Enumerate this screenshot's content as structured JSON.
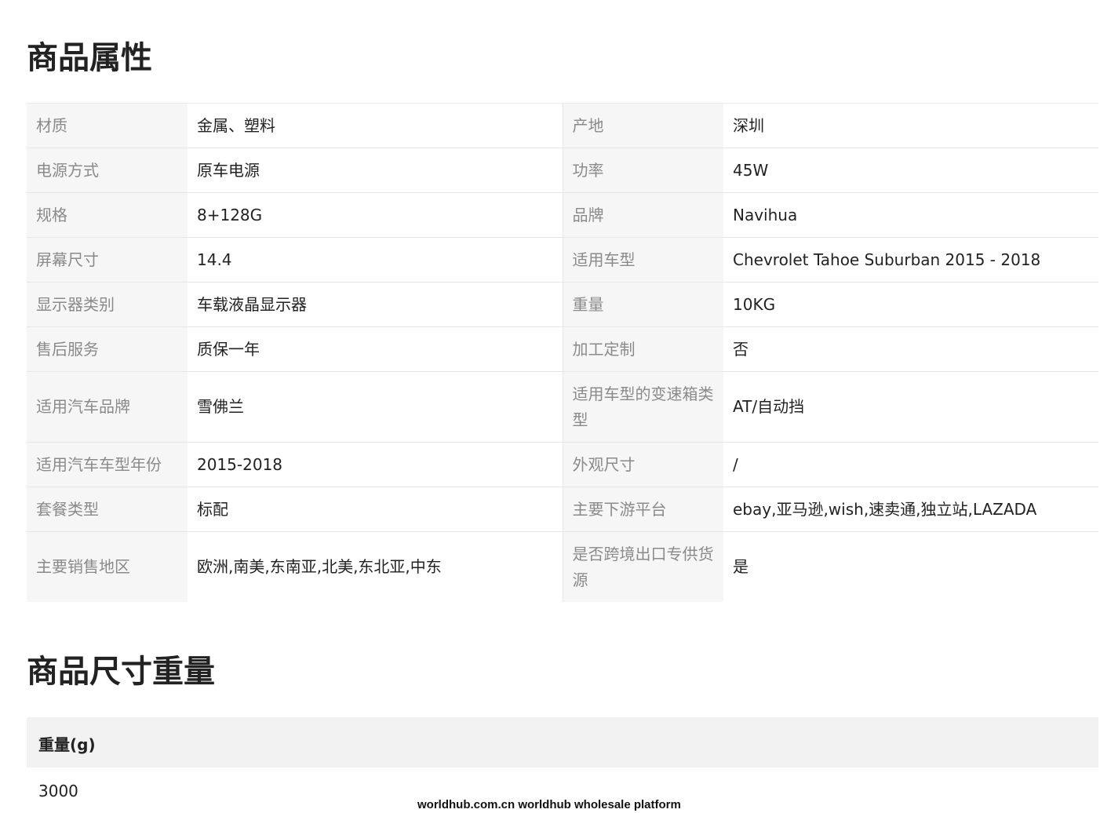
{
  "section1": {
    "title": "商品属性",
    "rows": [
      {
        "k1": "材质",
        "v1": "金属、塑料",
        "k2": "产地",
        "v2": "深圳"
      },
      {
        "k1": "电源方式",
        "v1": "原车电源",
        "k2": "功率",
        "v2": "45W"
      },
      {
        "k1": "规格",
        "v1": "8+128G",
        "k2": "品牌",
        "v2": "Navihua"
      },
      {
        "k1": "屏幕尺寸",
        "v1": "14.4",
        "k2": "适用车型",
        "v2": "Chevrolet Tahoe Suburban 2015 - 2018"
      },
      {
        "k1": "显示器类别",
        "v1": "车载液晶显示器",
        "k2": "重量",
        "v2": "10KG"
      },
      {
        "k1": "售后服务",
        "v1": "质保一年",
        "k2": "加工定制",
        "v2": "否"
      },
      {
        "k1": "适用汽车品牌",
        "v1": "雪佛兰",
        "k2": "适用车型的变速箱类型",
        "v2": "AT/自动挡"
      },
      {
        "k1": "适用汽车车型年份",
        "v1": "2015-2018",
        "k2": "外观尺寸",
        "v2": "/"
      },
      {
        "k1": "套餐类型",
        "v1": "标配",
        "k2": "主要下游平台",
        "v2": "ebay,亚马逊,wish,速卖通,独立站,LAZADA"
      },
      {
        "k1": "主要销售地区",
        "v1": "欧洲,南美,东南亚,北美,东北亚,中东",
        "k2": "是否跨境出口专供货源",
        "v2": "是"
      }
    ]
  },
  "section2": {
    "title": "商品尺寸重量",
    "header": "重量(g)",
    "value": "3000"
  },
  "watermark": "worldhub.com.cn worldhub wholesale platform"
}
